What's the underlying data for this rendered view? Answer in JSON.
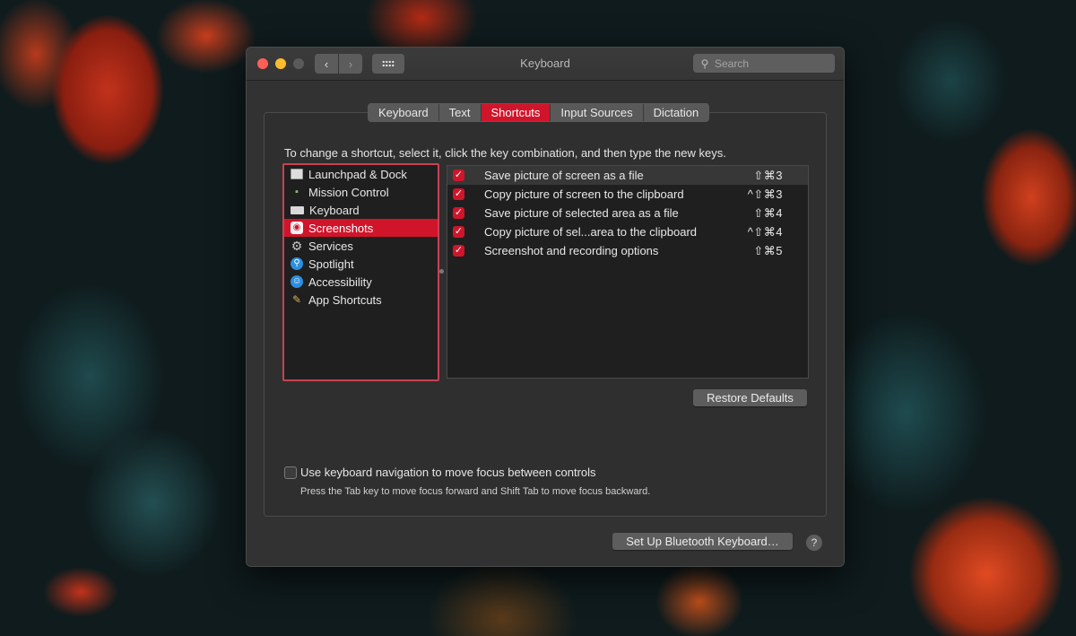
{
  "window": {
    "title": "Keyboard",
    "search_placeholder": "Search",
    "nav_back": "‹",
    "nav_forward": "›"
  },
  "tabs": [
    {
      "label": "Keyboard",
      "active": false
    },
    {
      "label": "Text",
      "active": false
    },
    {
      "label": "Shortcuts",
      "active": true
    },
    {
      "label": "Input Sources",
      "active": false
    },
    {
      "label": "Dictation",
      "active": false
    }
  ],
  "instruction": "To change a shortcut, select it, click the key combination, and then type the new keys.",
  "categories": [
    {
      "label": "Launchpad & Dock",
      "icon": "launchpad-icon"
    },
    {
      "label": "Mission Control",
      "icon": "mission-control-icon"
    },
    {
      "label": "Keyboard",
      "icon": "keyboard-icon"
    },
    {
      "label": "Screenshots",
      "icon": "screenshot-icon",
      "selected": true
    },
    {
      "label": "Services",
      "icon": "gear-icon"
    },
    {
      "label": "Spotlight",
      "icon": "spotlight-icon"
    },
    {
      "label": "Accessibility",
      "icon": "accessibility-icon"
    },
    {
      "label": "App Shortcuts",
      "icon": "app-shortcuts-icon"
    }
  ],
  "shortcuts": [
    {
      "checked": true,
      "label": "Save picture of screen as a file",
      "keys": "⇧⌘3"
    },
    {
      "checked": true,
      "label": "Copy picture of screen to the clipboard",
      "keys": "^⇧⌘3"
    },
    {
      "checked": true,
      "label": "Save picture of selected area as a file",
      "keys": "⇧⌘4"
    },
    {
      "checked": true,
      "label": "Copy picture of sel...area to the clipboard",
      "keys": "^⇧⌘4"
    },
    {
      "checked": true,
      "label": "Screenshot and recording options",
      "keys": "⇧⌘5"
    }
  ],
  "buttons": {
    "restore_defaults": "Restore Defaults",
    "setup_bluetooth": "Set Up Bluetooth Keyboard…",
    "help": "?"
  },
  "keyboard_navigation": {
    "checked": false,
    "label": "Use keyboard navigation to move focus between controls",
    "help": "Press the Tab key to move focus forward and Shift Tab to move focus backward."
  },
  "colors": {
    "accent": "#d0152b",
    "close": "#fe5f57",
    "minimize": "#febc2e"
  }
}
